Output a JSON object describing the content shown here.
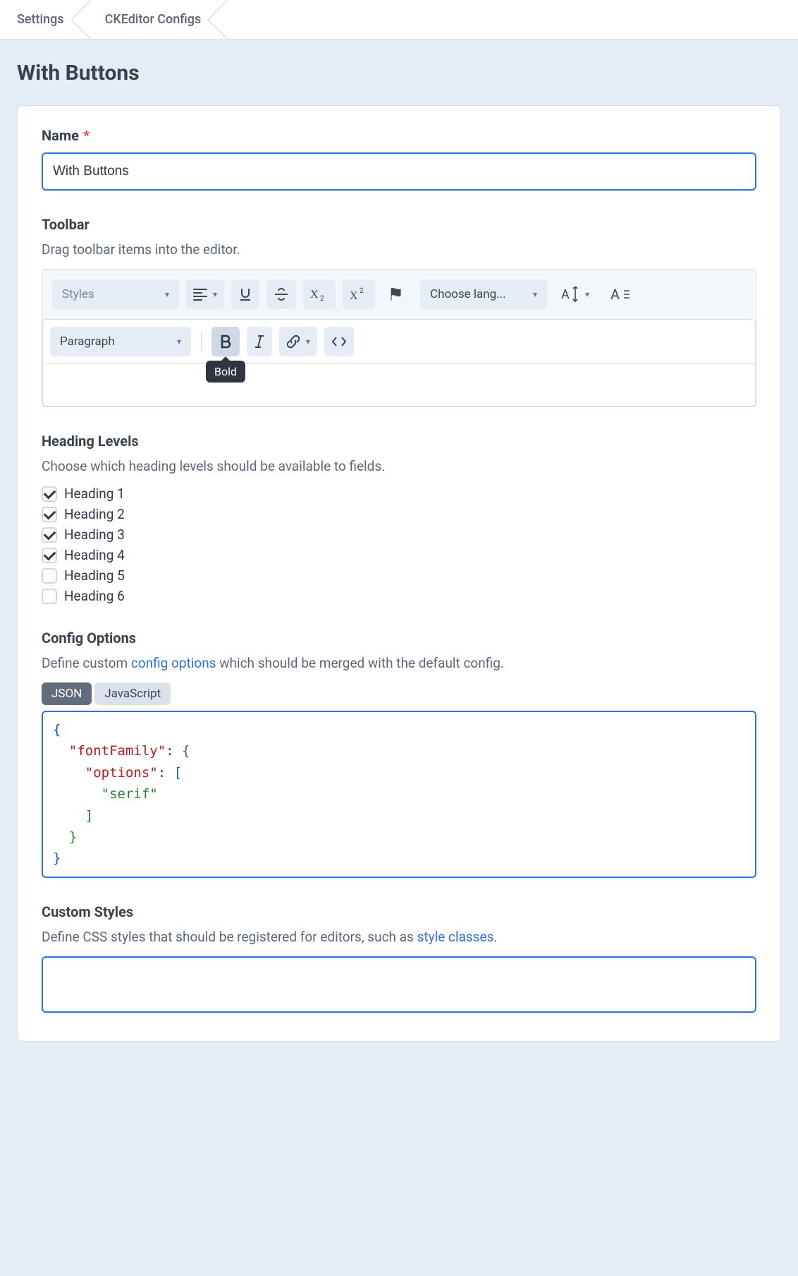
{
  "breadcrumb": {
    "items": [
      "Settings",
      "CKEditor Configs"
    ]
  },
  "page": {
    "title": "With Buttons"
  },
  "name": {
    "label": "Name",
    "value": "With Buttons"
  },
  "toolbar": {
    "label": "Toolbar",
    "helper": "Drag toolbar items into the editor.",
    "row1": {
      "styles_label": "Styles",
      "lang_label": "Choose lang..."
    },
    "row2": {
      "paragraph_label": "Paragraph",
      "bold_tooltip": "Bold"
    }
  },
  "headings": {
    "label": "Heading Levels",
    "helper": "Choose which heading levels should be available to fields.",
    "items": [
      {
        "label": "Heading 1",
        "checked": true
      },
      {
        "label": "Heading 2",
        "checked": true
      },
      {
        "label": "Heading 3",
        "checked": true
      },
      {
        "label": "Heading 4",
        "checked": true
      },
      {
        "label": "Heading 5",
        "checked": false
      },
      {
        "label": "Heading 6",
        "checked": false
      }
    ]
  },
  "config": {
    "label": "Config Options",
    "helper_pre": "Define custom ",
    "helper_link": "config options",
    "helper_post": " which should be merged with the default config.",
    "tabs": {
      "json": "JSON",
      "js": "JavaScript",
      "active": "json"
    },
    "code": {
      "l2_key": "\"fontFamily\"",
      "l3_key": "\"options\"",
      "l4_str": "\"serif\""
    }
  },
  "custom_styles": {
    "label": "Custom Styles",
    "helper_pre": "Define CSS styles that should be registered for editors, such as ",
    "helper_link": "style classes",
    "helper_post": "."
  }
}
